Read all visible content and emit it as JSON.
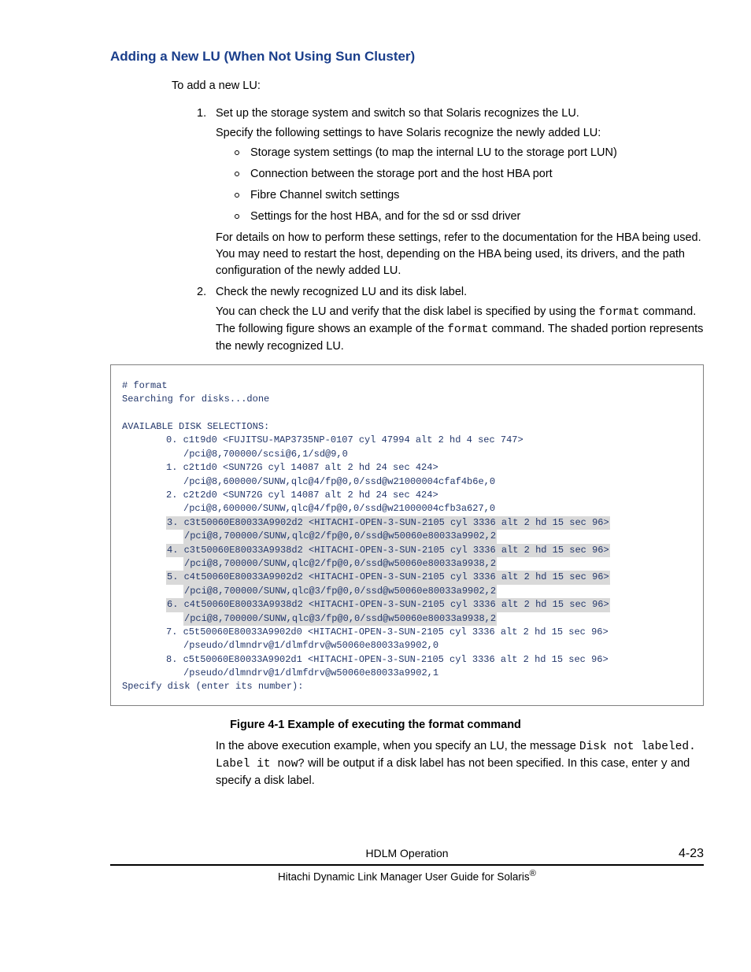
{
  "heading": "Adding a New LU (When Not Using Sun Cluster)",
  "intro": "To add a new LU:",
  "steps": {
    "s1": {
      "num": "1.",
      "lead": "Set up the storage system and switch so that Solaris recognizes the LU.",
      "para": "Specify the following settings to have Solaris recognize the newly added LU:",
      "bullets": {
        "b1": "Storage system settings (to map the internal LU to the storage port LUN)",
        "b2": "Connection between the storage port and the host HBA port",
        "b3": "Fibre Channel switch settings",
        "b4": "Settings for the host HBA, and for the sd or ssd driver"
      },
      "tail": "For details on how to perform these settings, refer to the documentation for the HBA being used. You may need to restart the host, depending on the HBA being used, its drivers, and the path configuration of the newly added LU."
    },
    "s2": {
      "num": "2.",
      "lead": "Check the newly recognized LU and its disk label.",
      "p1a": "You can check the LU and verify that the disk label is specified by using the ",
      "p1b": " command. The following figure shows an example of the ",
      "p1c": " command. The shaded portion represents the newly recognized LU.",
      "code": "format"
    }
  },
  "fig": {
    "l1": "# format",
    "l2": "Searching for disks...done",
    "l3": "AVAILABLE DISK SELECTIONS:",
    "d0a": "0. c1t9d0 <FUJITSU-MAP3735NP-0107 cyl 47994 alt 2 hd 4 sec 747>",
    "d0b": "/pci@8,700000/scsi@6,1/sd@9,0",
    "d1a": "1. c2t1d0 <SUN72G cyl 14087 alt 2 hd 24 sec 424>",
    "d1b": "/pci@8,600000/SUNW,qlc@4/fp@0,0/ssd@w21000004cfaf4b6e,0",
    "d2a": "2. c2t2d0 <SUN72G cyl 14087 alt 2 hd 24 sec 424>",
    "d2b": "/pci@8,600000/SUNW,qlc@4/fp@0,0/ssd@w21000004cfb3a627,0",
    "d3a": "3. c3t50060E80033A9902d2 <HITACHI-OPEN-3-SUN-2105 cyl 3336 alt 2 hd 15 sec 96>",
    "d3b": "/pci@8,700000/SUNW,qlc@2/fp@0,0/ssd@w50060e80033a9902,2",
    "d4a": "4. c3t50060E80033A9938d2 <HITACHI-OPEN-3-SUN-2105 cyl 3336 alt 2 hd 15 sec 96>",
    "d4b": "/pci@8,700000/SUNW,qlc@2/fp@0,0/ssd@w50060e80033a9938,2",
    "d5a": "5. c4t50060E80033A9902d2 <HITACHI-OPEN-3-SUN-2105 cyl 3336 alt 2 hd 15 sec 96>",
    "d5b": "/pci@8,700000/SUNW,qlc@3/fp@0,0/ssd@w50060e80033a9902,2",
    "d6a": "6. c4t50060E80033A9938d2 <HITACHI-OPEN-3-SUN-2105 cyl 3336 alt 2 hd 15 sec 96>",
    "d6b": "/pci@8,700000/SUNW,qlc@3/fp@0,0/ssd@w50060e80033a9938,2",
    "d7a": "7. c5t50060E80033A9902d0 <HITACHI-OPEN-3-SUN-2105 cyl 3336 alt 2 hd 15 sec 96>",
    "d7b": "/pseudo/dlmndrv@1/dlmfdrv@w50060e80033a9902,0",
    "d8a": "8. c5t50060E80033A9902d1 <HITACHI-OPEN-3-SUN-2105 cyl 3336 alt 2 hd 15 sec 96>",
    "d8b": "/pseudo/dlmndrv@1/dlmfdrv@w50060e80033a9902,1",
    "l99": "Specify disk (enter its number):"
  },
  "caption": "Figure 4-1 Example of executing the format command",
  "after": {
    "t1": "In the above execution example, when you specify an LU, the message ",
    "code1": "Disk not labeled. Label it now?",
    "t2": " will be output if a disk label has not been specified. In this case, enter ",
    "code2": "y",
    "t3": " and specify a disk label."
  },
  "footer": {
    "center": "HDLM Operation",
    "right": "4-23",
    "guide_a": "Hitachi Dynamic Link Manager User Guide for Solaris",
    "reg": "®"
  }
}
